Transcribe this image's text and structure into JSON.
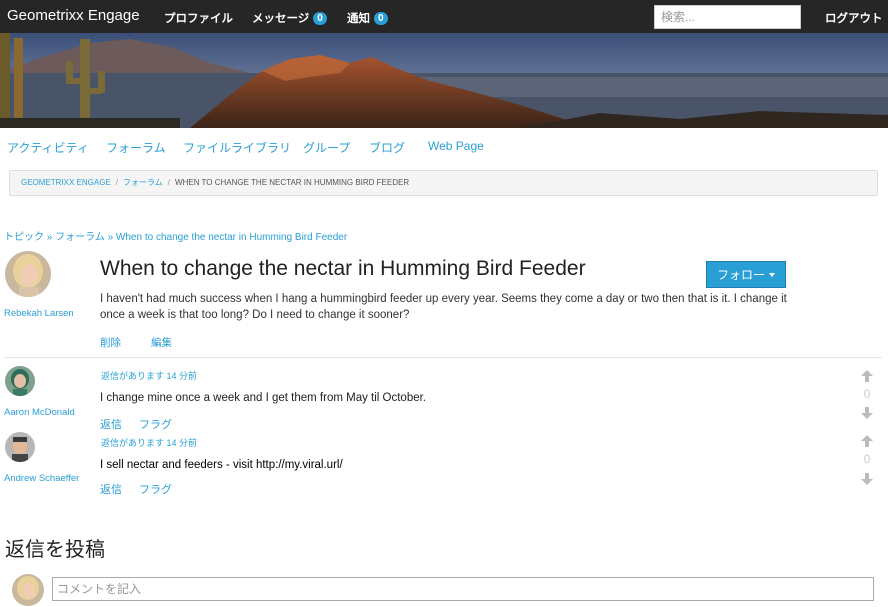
{
  "navbar": {
    "brand": "Geometrixx Engage",
    "profile": "プロファイル",
    "messages": "メッセージ",
    "messages_count": "0",
    "notifications": "通知",
    "notifications_count": "0",
    "search_placeholder": "検索...",
    "logout": "ログアウト"
  },
  "tabs": [
    "アクティビティ",
    "フォーラム",
    "ファイルライブラリ",
    "グループ",
    "ブログ",
    "Web Page"
  ],
  "breadcrumb": {
    "items": [
      "GEOMETRIXX ENGAGE",
      "フォーラム"
    ],
    "current": "WHEN TO CHANGE THE NECTAR IN HUMMING BIRD FEEDER",
    "separator": "/"
  },
  "trail": "トピック » フォーラム » When to change the nectar in Humming Bird Feeder",
  "topic": {
    "author": "Rebekah Larsen",
    "title": "When to change the nectar in Humming Bird Feeder",
    "follow_label": "フォロー",
    "body": "I haven't had much success when I hang a hummingbird feeder up every year. Seems they come a day or two then that is it. I change it once a week is that too long? Do I need to change it sooner?",
    "delete_label": "削除",
    "edit_label": "編集"
  },
  "replies": [
    {
      "author": "Aaron McDonald",
      "meta": "返信があります 14 分前",
      "text": "I change mine once a week and I get them from May til October.",
      "reply_label": "返信",
      "flag_label": "フラグ",
      "votes": "0"
    },
    {
      "author": "Andrew Schaeffer",
      "meta": "返信があります 14 分前",
      "text": "I sell nectar and feeders - visit http://my.viral.url/",
      "reply_label": "返信",
      "flag_label": "フラグ",
      "votes": "0"
    }
  ],
  "compose": {
    "heading": "返信を投稿",
    "placeholder": "コメントを記入"
  },
  "colors": {
    "navbar": "#262626",
    "accent": "#2a9fd6",
    "breadcrumb_bg": "#f5f5f5"
  },
  "icons": {
    "upvote": "arrow-up-icon",
    "downvote": "arrow-down-icon",
    "caret": "caret-down-icon"
  }
}
